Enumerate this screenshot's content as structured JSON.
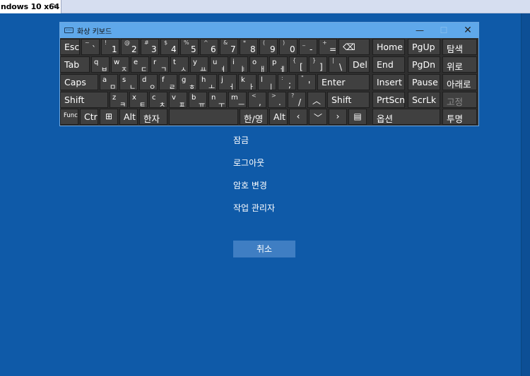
{
  "host": {
    "tab_label": "ndows 10 x64",
    "tab_close": "✕"
  },
  "osk": {
    "title": "화상 키보드",
    "minimize": "—",
    "maximize": "☐",
    "close": "✕",
    "rows": [
      [
        {
          "id": "esc",
          "main": "Esc"
        },
        {
          "id": "backtick",
          "top": "~",
          "bot": "`"
        },
        {
          "id": "1",
          "top": "!",
          "bot": "1"
        },
        {
          "id": "2",
          "top": "@",
          "bot": "2"
        },
        {
          "id": "3",
          "top": "#",
          "bot": "3"
        },
        {
          "id": "4",
          "top": "$",
          "bot": "4"
        },
        {
          "id": "5",
          "top": "%",
          "bot": "5"
        },
        {
          "id": "6",
          "top": "^",
          "bot": "6"
        },
        {
          "id": "7",
          "top": "&",
          "bot": "7"
        },
        {
          "id": "8",
          "top": "*",
          "bot": "8"
        },
        {
          "id": "9",
          "top": "(",
          "bot": "9"
        },
        {
          "id": "0",
          "top": ")",
          "bot": "0"
        },
        {
          "id": "minus",
          "top": "_",
          "bot": "-"
        },
        {
          "id": "equals",
          "top": "+",
          "bot": "="
        },
        {
          "id": "backspace",
          "main": "⌫"
        },
        {
          "id": "home",
          "main": "Home"
        },
        {
          "id": "pgup",
          "main": "PgUp"
        },
        {
          "id": "hanja-search",
          "main": "탐색"
        }
      ],
      [
        {
          "id": "tab",
          "main": "Tab"
        },
        {
          "id": "q",
          "lat": "q",
          "ko": "ㅂ"
        },
        {
          "id": "w",
          "lat": "w",
          "ko": "ㅈ"
        },
        {
          "id": "e",
          "lat": "e",
          "ko": "ㄷ"
        },
        {
          "id": "r",
          "lat": "r",
          "ko": "ㄱ"
        },
        {
          "id": "t",
          "lat": "t",
          "ko": "ㅅ"
        },
        {
          "id": "y",
          "lat": "y",
          "ko": "ㅛ"
        },
        {
          "id": "u",
          "lat": "u",
          "ko": "ㅕ"
        },
        {
          "id": "i",
          "lat": "i",
          "ko": "ㅑ"
        },
        {
          "id": "o",
          "lat": "o",
          "ko": "ㅐ"
        },
        {
          "id": "p",
          "lat": "p",
          "ko": "ㅔ"
        },
        {
          "id": "lbracket",
          "top": "{",
          "bot": "["
        },
        {
          "id": "rbracket",
          "top": "}",
          "bot": "]"
        },
        {
          "id": "backslash",
          "top": "|",
          "bot": "\\"
        },
        {
          "id": "del",
          "main": "Del"
        },
        {
          "id": "end",
          "main": "End"
        },
        {
          "id": "pgdn",
          "main": "PgDn"
        },
        {
          "id": "up-nav",
          "main": "위로"
        }
      ],
      [
        {
          "id": "caps",
          "main": "Caps"
        },
        {
          "id": "a",
          "lat": "a",
          "ko": "ㅁ"
        },
        {
          "id": "s",
          "lat": "s",
          "ko": "ㄴ"
        },
        {
          "id": "d",
          "lat": "d",
          "ko": "ㅇ"
        },
        {
          "id": "f",
          "lat": "f",
          "ko": "ㄹ"
        },
        {
          "id": "g",
          "lat": "g",
          "ko": "ㅎ"
        },
        {
          "id": "h",
          "lat": "h",
          "ko": "ㅗ"
        },
        {
          "id": "j",
          "lat": "j",
          "ko": "ㅓ"
        },
        {
          "id": "k",
          "lat": "k",
          "ko": "ㅏ"
        },
        {
          "id": "l",
          "lat": "l",
          "ko": "ㅣ"
        },
        {
          "id": "semicolon",
          "top": ":",
          "bot": ";"
        },
        {
          "id": "quote",
          "top": "\"",
          "bot": "'"
        },
        {
          "id": "enter",
          "main": "Enter"
        },
        {
          "id": "insert",
          "main": "Insert"
        },
        {
          "id": "pause",
          "main": "Pause"
        },
        {
          "id": "down-nav",
          "main": "아래로"
        }
      ],
      [
        {
          "id": "lshift",
          "main": "Shift"
        },
        {
          "id": "z",
          "lat": "z",
          "ko": "ㅋ"
        },
        {
          "id": "x",
          "lat": "x",
          "ko": "ㅌ"
        },
        {
          "id": "c",
          "lat": "c",
          "ko": "ㅊ"
        },
        {
          "id": "v",
          "lat": "v",
          "ko": "ㅍ"
        },
        {
          "id": "b",
          "lat": "b",
          "ko": "ㅠ"
        },
        {
          "id": "n",
          "lat": "n",
          "ko": "ㅜ"
        },
        {
          "id": "m",
          "lat": "m",
          "ko": "ㅡ"
        },
        {
          "id": "comma",
          "top": "<",
          "bot": ","
        },
        {
          "id": "period",
          "top": ">",
          "bot": "."
        },
        {
          "id": "slash",
          "top": "?",
          "bot": "/"
        },
        {
          "id": "arrow-up",
          "main": "︿"
        },
        {
          "id": "rshift",
          "main": "Shift"
        },
        {
          "id": "prtscn",
          "main": "PrtScn"
        },
        {
          "id": "scrlk",
          "main": "ScrLk"
        },
        {
          "id": "fixed",
          "main": "고정",
          "dim": true
        }
      ],
      [
        {
          "id": "fn",
          "main": "Func"
        },
        {
          "id": "ctrl",
          "main": "Ctrl"
        },
        {
          "id": "win",
          "main": "⊞"
        },
        {
          "id": "alt-left",
          "main": "Alt"
        },
        {
          "id": "hanja",
          "main": "한자"
        },
        {
          "id": "space",
          "main": ""
        },
        {
          "id": "han-eng",
          "main": "한/영"
        },
        {
          "id": "alt-right",
          "main": "Alt"
        },
        {
          "id": "arrow-left",
          "main": "‹"
        },
        {
          "id": "arrow-down",
          "main": "﹀"
        },
        {
          "id": "arrow-right",
          "main": "›"
        },
        {
          "id": "menu",
          "main": "▤"
        },
        {
          "id": "options",
          "main": "옵션"
        },
        {
          "id": "fade",
          "main": "투명"
        }
      ]
    ]
  },
  "menu": {
    "items": [
      "잠금",
      "로그아웃",
      "암호 변경",
      "작업 관리자"
    ],
    "cancel": "취소"
  },
  "colors": {
    "background": "#0f5aa8",
    "key": "#404040",
    "title_bar": "#5fa8ea",
    "cancel_button": "#3f7ec3"
  }
}
